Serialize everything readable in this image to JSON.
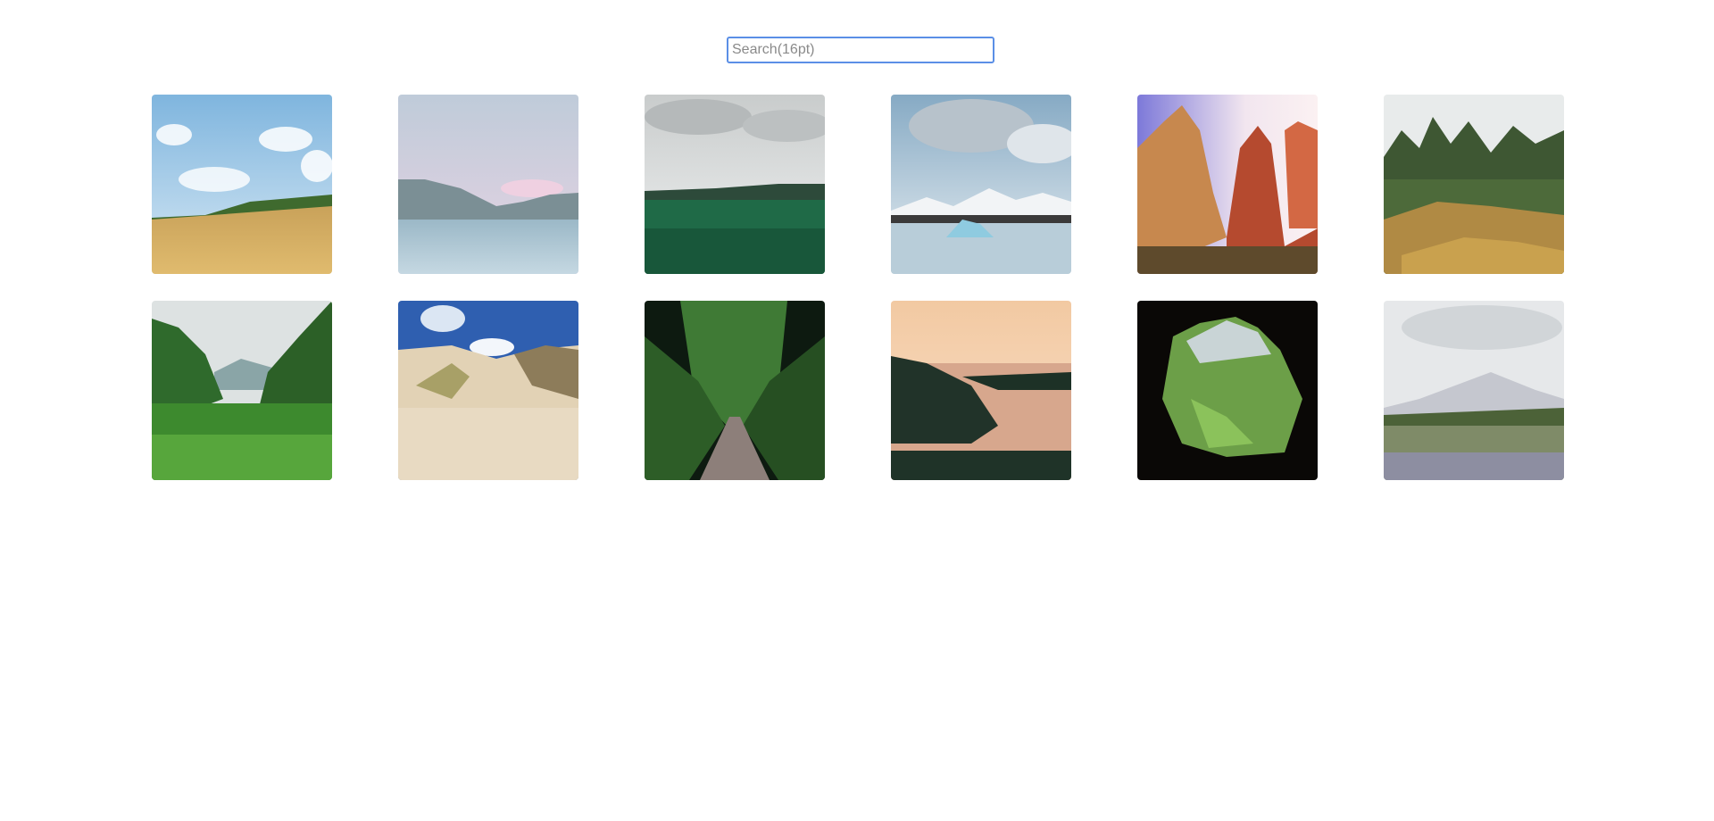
{
  "search": {
    "placeholder": "Search(16pt)",
    "value": ""
  },
  "gallery": {
    "items": [
      {
        "scene": "wheat-field"
      },
      {
        "scene": "lake-mountains"
      },
      {
        "scene": "green-meadow"
      },
      {
        "scene": "glacier-lagoon"
      },
      {
        "scene": "red-canyon"
      },
      {
        "scene": "autumn-garden"
      },
      {
        "scene": "jungle-valley"
      },
      {
        "scene": "sand-dunes"
      },
      {
        "scene": "forest-path"
      },
      {
        "scene": "sunset-river"
      },
      {
        "scene": "cave-view"
      },
      {
        "scene": "lupine-mountain"
      }
    ]
  },
  "colors": {
    "focus_border": "#5b8fe6",
    "background": "#ffffff"
  }
}
